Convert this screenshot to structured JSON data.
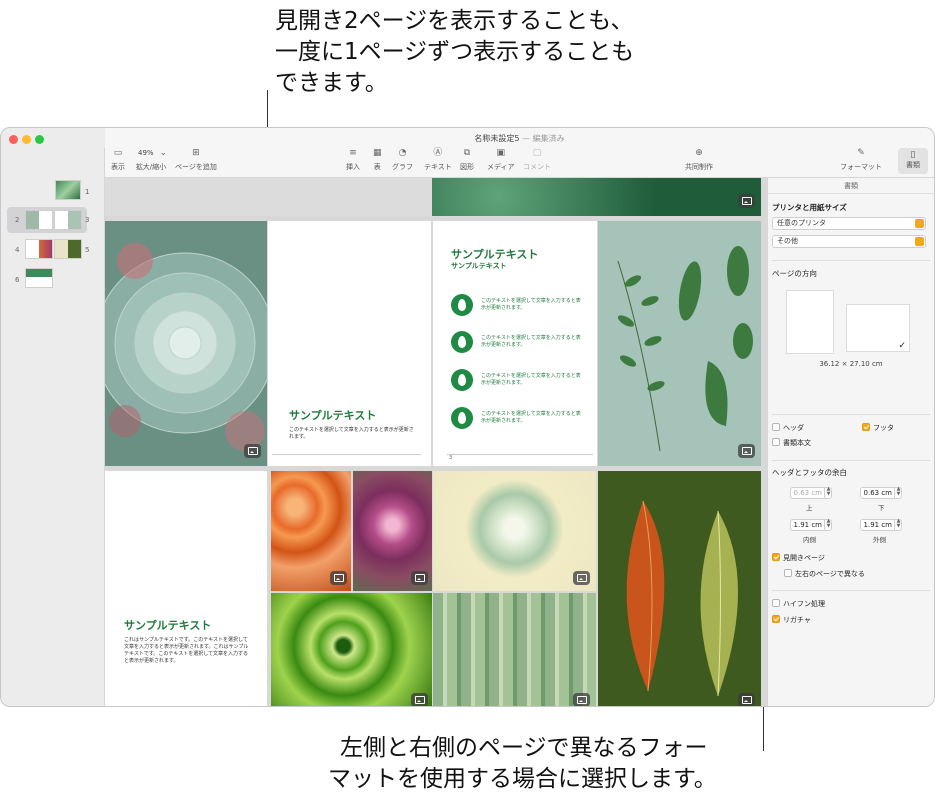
{
  "callouts": {
    "top": [
      "見開き2ページを表示することも、",
      "一度に1ページずつ表示することも",
      "できます。"
    ],
    "bottom": [
      "左側と右側のページで異なるフォー",
      "マットを使用する場合に選択します。"
    ]
  },
  "window": {
    "title": "名称未設定5",
    "title_suffix": "— 編集済み",
    "zoom": "49%",
    "toolbar": {
      "view": "表示",
      "zoom_label": "拡大/縮小",
      "add_page": "ページを追加",
      "insert": "挿入",
      "table": "表",
      "chart": "グラフ",
      "text": "テキスト",
      "shape": "図形",
      "media": "メディア",
      "comment": "コメント",
      "collaborate": "共同制作",
      "format": "フォーマット",
      "document": "書類"
    }
  },
  "sidebar": {
    "page_numbers": [
      "1",
      "2",
      "3",
      "4",
      "5",
      "6"
    ]
  },
  "pages": {
    "right_top": {
      "heading": "サンプルテキスト",
      "body": "このテキストを選択して文章を入力すると表示が更新されます。"
    },
    "toc_page": {
      "title": "サンプルテキスト",
      "subtitle": "サンプルテキスト",
      "bullets": [
        "このテキストを選択して文章を入力すると表示が更新されます。",
        "このテキストを選択して文章を入力すると表示が更新されます。",
        "このテキストを選択して文章を入力すると表示が更新されます。",
        "このテキストを選択して文章を入力すると表示が更新されます。"
      ],
      "footer_num": "3"
    },
    "bottom_left": {
      "heading": "サンプルテキスト",
      "body": "これはサンプルテキストです。このテキストを選択して文章を入力すると表示が更新されます。これはサンプルテキストです。このテキストを選択して文章を入力すると表示が更新されます。"
    }
  },
  "inspector": {
    "tab": "書類",
    "printer_section": "プリンタと用紙サイズ",
    "printer": "任意のプリンタ",
    "paper": "その他",
    "orientation_section": "ページの方向",
    "page_size": "36.12 × 27.10 cm",
    "header_label": "ヘッダ",
    "footer_label": "フッタ",
    "body_label": "書類本文",
    "margins_section": "ヘッダとフッタの余白",
    "top_value": "0.63 cm",
    "top_caption": "上",
    "bottom_value": "0.63 cm",
    "bottom_caption": "下",
    "inside_value": "1.91 cm",
    "inside_caption": "内側",
    "outside_value": "1.91 cm",
    "outside_caption": "外側",
    "facing_pages": "見開きページ",
    "different_lr": "左右のページで異なる",
    "hyphenation": "ハイフン処理",
    "ligatures": "リガチャ"
  }
}
